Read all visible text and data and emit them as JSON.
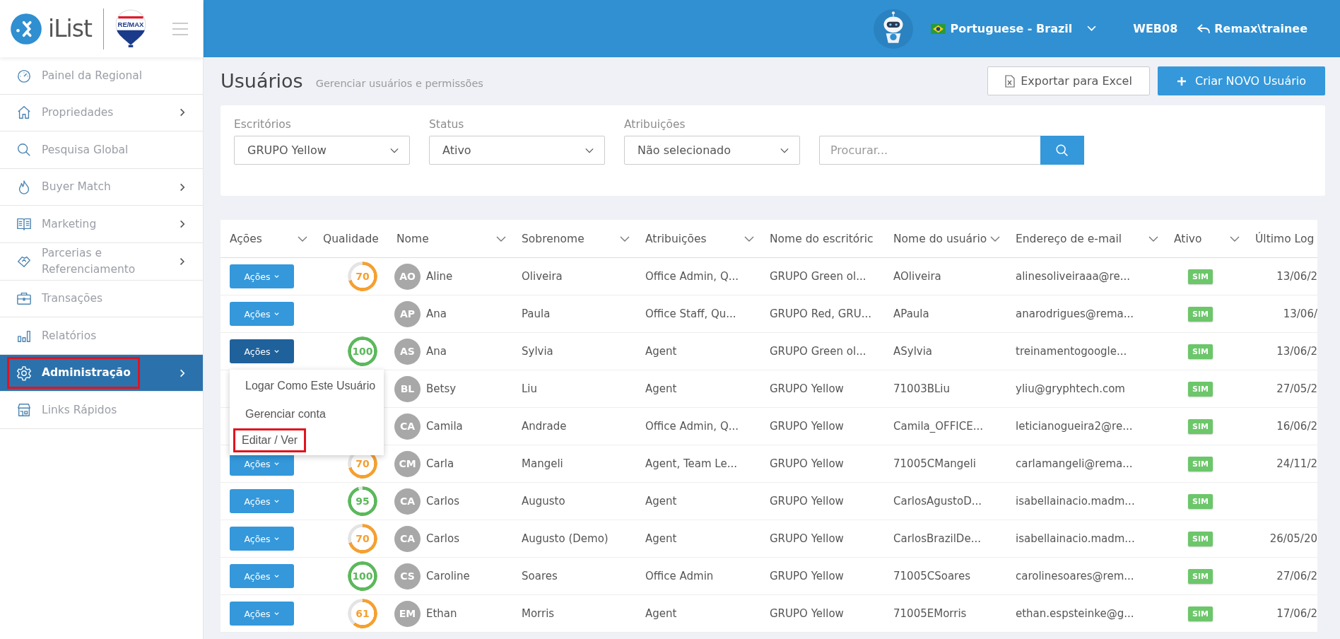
{
  "brand": {
    "name": "iList",
    "badge": "RE/MAX"
  },
  "topbar": {
    "language": "Portuguese - Brazil",
    "workstation": "WEB08",
    "user": "Remax\\trainee"
  },
  "sidebar": {
    "items": [
      {
        "label": "Painel da Regional",
        "expandable": false,
        "selected": false,
        "highlighted": false
      },
      {
        "label": "Propriedades",
        "expandable": true,
        "selected": false,
        "highlighted": false
      },
      {
        "label": "Pesquisa Global",
        "expandable": false,
        "selected": false,
        "highlighted": false
      },
      {
        "label": "Buyer Match",
        "expandable": true,
        "selected": false,
        "highlighted": false
      },
      {
        "label": "Marketing",
        "expandable": true,
        "selected": false,
        "highlighted": false
      },
      {
        "label": "Parcerias e Referenciamento",
        "expandable": true,
        "selected": false,
        "highlighted": false
      },
      {
        "label": "Transações",
        "expandable": false,
        "selected": false,
        "highlighted": false
      },
      {
        "label": "Relatórios",
        "expandable": false,
        "selected": false,
        "highlighted": false
      },
      {
        "label": "Administração",
        "expandable": true,
        "selected": true,
        "highlighted": true
      },
      {
        "label": "Links Rápidos",
        "expandable": false,
        "selected": false,
        "highlighted": false
      }
    ]
  },
  "page": {
    "title": "Usuários",
    "subtitle": "Gerenciar usuários e permissões",
    "export_button": "Exportar para Excel",
    "create_button": "Criar NOVO Usuário"
  },
  "filters": {
    "selects": [
      {
        "label": "Escritórios",
        "value": "GRUPO Yellow"
      },
      {
        "label": "Status",
        "value": "Ativo"
      },
      {
        "label": "Atribuições",
        "value": "Não selecionado"
      }
    ],
    "search": {
      "placeholder": "Procurar..."
    }
  },
  "table": {
    "columns": [
      {
        "label": "Ações",
        "filterable": true
      },
      {
        "label": "Qualidade",
        "filterable": false
      },
      {
        "label": "Nome",
        "filterable": true
      },
      {
        "label": "Sobrenome",
        "filterable": true
      },
      {
        "label": "Atribuições",
        "filterable": true
      },
      {
        "label": "Nome do escritóric",
        "filterable": false
      },
      {
        "label": "Nome do usuário",
        "filterable": true
      },
      {
        "label": "Endereço de e-mail",
        "filterable": true
      },
      {
        "label": "Ativo",
        "filterable": true
      },
      {
        "label": "Último Log",
        "filterable": false
      }
    ],
    "rows": [
      {
        "action": {
          "label": "Ações",
          "open": false
        },
        "quality": {
          "score": "70",
          "color": "#f5a030"
        },
        "initials": "AO",
        "first_name": "Aline",
        "last_name": "Oliveira",
        "roles": "Office Admin, Q...",
        "office": "GRUPO Green ol...",
        "username": "AOliveira",
        "email": "alinesoliveiraaa@re...",
        "active": {
          "label": "SIM",
          "on": true
        },
        "last_login": "13/06/2"
      },
      {
        "action": {
          "label": "Ações",
          "open": false
        },
        "initials": "AP",
        "first_name": "Ana",
        "last_name": "Paula",
        "roles": "Office Staff, Qu...",
        "office": "GRUPO Red, GRU...",
        "username": "APaula",
        "email": "anarodrigues@rema...",
        "active": {
          "label": "SIM",
          "on": true
        },
        "last_login": "13/06/"
      },
      {
        "action": {
          "label": "Ações",
          "open": true
        },
        "quality": {
          "score": "100",
          "color": "#5cb85c"
        },
        "initials": "AS",
        "first_name": "Ana",
        "last_name": "Sylvia",
        "roles": "Agent",
        "office": "GRUPO Green ol...",
        "username": "ASylvia",
        "email": "treinamentogoogle...",
        "active": {
          "label": "SIM",
          "on": true
        },
        "last_login": "13/06/2"
      },
      {
        "initials": "BL",
        "first_name": "Betsy",
        "last_name": "Liu",
        "roles": "Agent",
        "office": "GRUPO Yellow",
        "username": "71003BLiu",
        "email": "yliu@gryphtech.com",
        "active": {
          "label": "SIM",
          "on": true
        },
        "last_login": "27/05/2"
      },
      {
        "initials": "CA",
        "first_name": "Camila",
        "last_name": "Andrade",
        "roles": "Office Admin, Q...",
        "office": "GRUPO Yellow",
        "username": "Camila_OFFICE...",
        "email": "leticianogueira2@re...",
        "active": {
          "label": "SIM",
          "on": true
        },
        "last_login": "16/06/2"
      },
      {
        "action": {
          "label": "Ações",
          "open": false
        },
        "quality": {
          "score": "70",
          "color": "#f5a030"
        },
        "initials": "CM",
        "first_name": "Carla",
        "last_name": "Mangeli",
        "roles": "Agent, Team Le...",
        "office": "GRUPO Yellow",
        "username": "71005CMangeli",
        "email": "carlamangeli@rema...",
        "active": {
          "label": "SIM",
          "on": true
        },
        "last_login": "24/11/2"
      },
      {
        "action": {
          "label": "Ações",
          "open": false
        },
        "quality": {
          "score": "95",
          "color": "#5cb85c"
        },
        "initials": "CA",
        "first_name": "Carlos",
        "last_name": "Augusto",
        "roles": "Agent",
        "office": "GRUPO Yellow",
        "username": "CarlosAgustoD...",
        "email": "isabellainacio.madm...",
        "active": {
          "label": "SIM",
          "on": true
        }
      },
      {
        "action": {
          "label": "Ações",
          "open": false
        },
        "quality": {
          "score": "70",
          "color": "#f5a030"
        },
        "initials": "CA",
        "first_name": "Carlos",
        "last_name": "Augusto (Demo)",
        "roles": "Agent",
        "office": "GRUPO Yellow",
        "username": "CarlosBrazilDe...",
        "email": "isabellainacio.madm...",
        "active": {
          "label": "SIM",
          "on": true
        },
        "last_login": "26/05/20"
      },
      {
        "action": {
          "label": "Ações",
          "open": false
        },
        "quality": {
          "score": "100",
          "color": "#5cb85c"
        },
        "initials": "CS",
        "first_name": "Caroline",
        "last_name": "Soares",
        "roles": "Office Admin",
        "office": "GRUPO Yellow",
        "username": "71005CSoares",
        "email": "carolinesoares@rem...",
        "active": {
          "label": "SIM",
          "on": true
        },
        "last_login": "27/06/2"
      },
      {
        "action": {
          "label": "Ações",
          "open": false
        },
        "quality": {
          "score": "61",
          "color": "#f5a030"
        },
        "initials": "EM",
        "first_name": "Ethan",
        "last_name": "Morris",
        "roles": "Agent",
        "office": "GRUPO Yellow",
        "username": "71005EMorris",
        "email": "ethan.espsteinke@g...",
        "active": {
          "label": "SIM",
          "on": true
        },
        "last_login": "17/06/2"
      }
    ],
    "action_menu": {
      "items": [
        {
          "label": "Logar Como Este Usuário",
          "highlighted": false
        },
        {
          "label": "Gerenciar conta",
          "highlighted": false
        },
        {
          "label": "Editar / Ver",
          "highlighted": true
        }
      ]
    }
  }
}
